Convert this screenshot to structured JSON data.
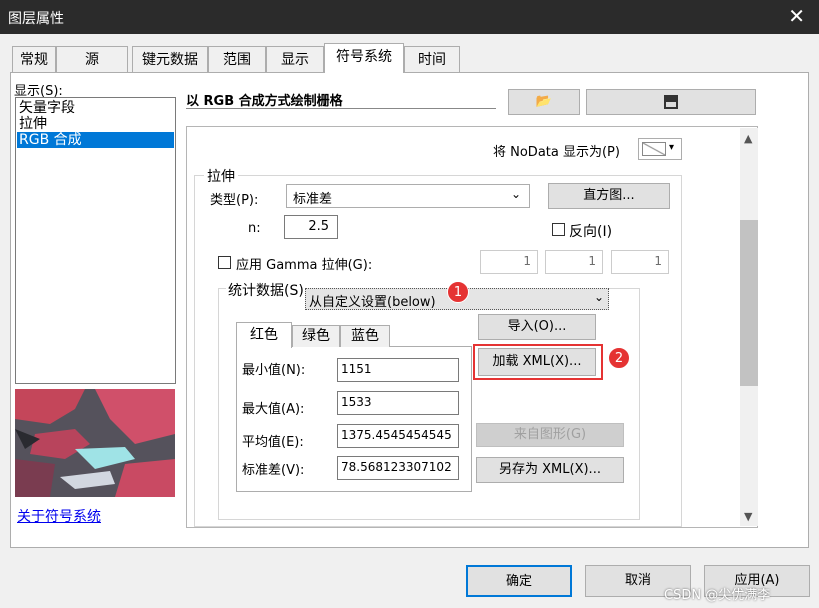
{
  "window": {
    "title": "图层属性"
  },
  "tabs": [
    "常规",
    "源",
    "键元数据",
    "范围",
    "显示",
    "符号系统",
    "时间"
  ],
  "left": {
    "show_label": "显示(S):",
    "items": [
      "矢量字段",
      "拉伸",
      "RGB 合成"
    ],
    "link": "关于符号系统"
  },
  "main": {
    "heading": "以 RGB 合成方式绘制栅格",
    "nodata_label": "将 NoData 显示为(P)",
    "stretch_group": "拉伸",
    "type_label": "类型(P):",
    "type_value": "标准差",
    "histogram_button": "直方图...",
    "n_label": "n:",
    "n_value": "2.5",
    "invert_label": "反向(I)",
    "gamma_label": "应用 Gamma 拉伸(G):",
    "gamma_values": [
      "1",
      "1",
      "1"
    ],
    "stats_label": "统计数据(S)",
    "stats_value": "从自定义设置(below)",
    "import_button": "导入(O)...",
    "load_xml_button": "加载 XML(X)...",
    "from_graphic_button": "来自图形(G)",
    "save_xml_button": "另存为 XML(X)...",
    "color_tabs": [
      "红色",
      "绿色",
      "蓝色"
    ],
    "fields": [
      {
        "label": "最小值(N):",
        "value": "1151"
      },
      {
        "label": "最大值(A):",
        "value": "1533"
      },
      {
        "label": "平均值(E):",
        "value": "1375.4545454545"
      },
      {
        "label": "标准差(V):",
        "value": "78.568123307102"
      }
    ],
    "markers": [
      "1",
      "2"
    ]
  },
  "footer": {
    "ok": "确定",
    "cancel": "取消",
    "apply": "应用(A)",
    "watermark": "CSDN @尖优满李"
  },
  "colors": {
    "accent": "#0078d7",
    "marker": "#e53333",
    "titlebar": "#2b2b2b"
  }
}
